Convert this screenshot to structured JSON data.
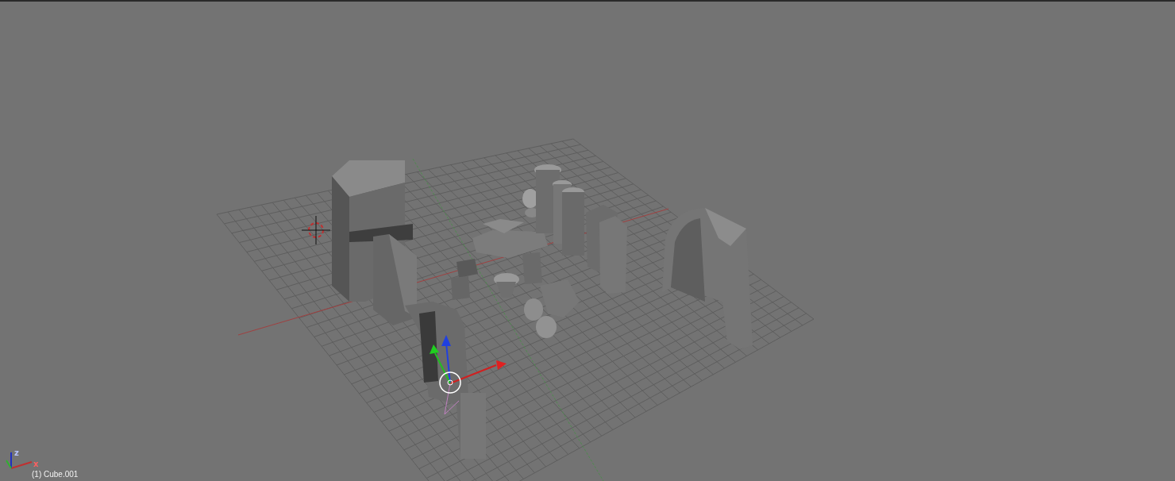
{
  "viewport": {
    "object_label": "(1) Cube.001",
    "axis_labels": [
      "z",
      "x"
    ]
  }
}
